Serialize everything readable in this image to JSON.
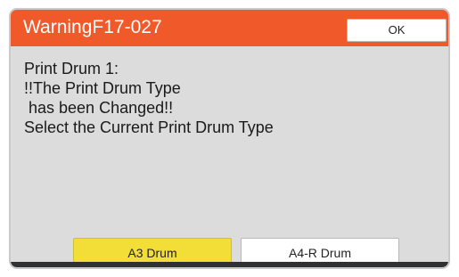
{
  "dialog": {
    "title": "WarningF17-027",
    "ok_label": "OK",
    "message_lines": [
      "Print Drum 1:",
      "!!The Print Drum Type",
      " has been Changed!!",
      "Select the Current Print Drum Type"
    ],
    "buttons": {
      "a3": "A3 Drum",
      "a4r": "A4-R Drum"
    },
    "selected": "A3 Drum"
  },
  "colors": {
    "title_bar": "#f05a2a",
    "dialog_body": "#dcdcdc",
    "selected_button": "#f3de37"
  }
}
